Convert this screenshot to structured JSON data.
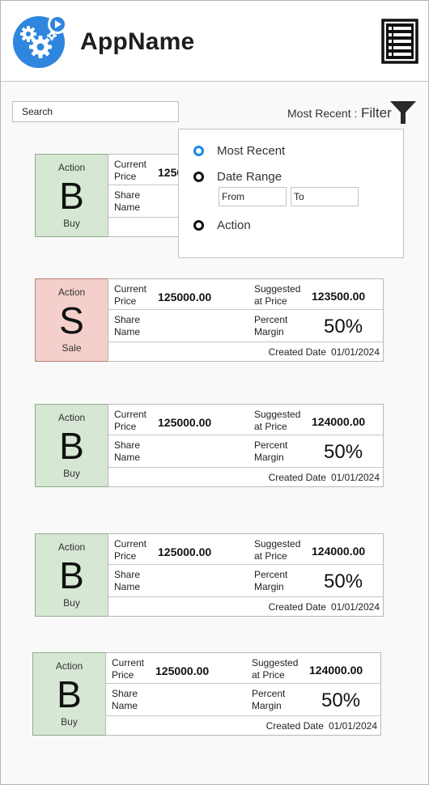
{
  "header": {
    "app_name": "AppName",
    "logo_icon": "gears-play-icon",
    "menu_icon": "list-menu-icon"
  },
  "search": {
    "placeholder": "Search"
  },
  "sort": {
    "label": "Most Recent :",
    "filter_label": "Filter",
    "filter_icon": "funnel-icon"
  },
  "filter_dropdown": {
    "options": [
      {
        "label": "Most Recent",
        "selected": true
      },
      {
        "label": "Date Range",
        "selected": false
      },
      {
        "label": "Action",
        "selected": false
      }
    ],
    "from_placeholder": "From",
    "to_placeholder": "To"
  },
  "labels": {
    "action": "Action",
    "current_price": "Current Price",
    "share_name": "Share Name",
    "suggested_price": "Suggested at Price",
    "percent_margin": "Percent Margin",
    "created_date": "Created Date"
  },
  "cards": [
    {
      "letter": "B",
      "action": "Buy",
      "current_price": "125000.00",
      "suggested_price": "",
      "share_name": "",
      "margin": "",
      "created_date": ""
    },
    {
      "letter": "S",
      "action": "Sale",
      "current_price": "125000.00",
      "suggested_price": "123500.00",
      "share_name": "",
      "margin": "50%",
      "created_date": "01/01/2024"
    },
    {
      "letter": "B",
      "action": "Buy",
      "current_price": "125000.00",
      "suggested_price": "124000.00",
      "share_name": "",
      "margin": "50%",
      "created_date": "01/01/2024"
    },
    {
      "letter": "B",
      "action": "Buy",
      "current_price": "125000.00",
      "suggested_price": "124000.00",
      "share_name": "",
      "margin": "50%",
      "created_date": "01/01/2024"
    },
    {
      "letter": "B",
      "action": "Buy",
      "current_price": "125000.00",
      "suggested_price": "124000.00",
      "share_name": "",
      "margin": "50%",
      "created_date": "01/01/2024"
    }
  ],
  "colors": {
    "buy_bg": "#d6e7d3",
    "sale_bg": "#f5cfcc",
    "logo_blue": "#2e86de",
    "radio_selected": "#1a86e8"
  }
}
